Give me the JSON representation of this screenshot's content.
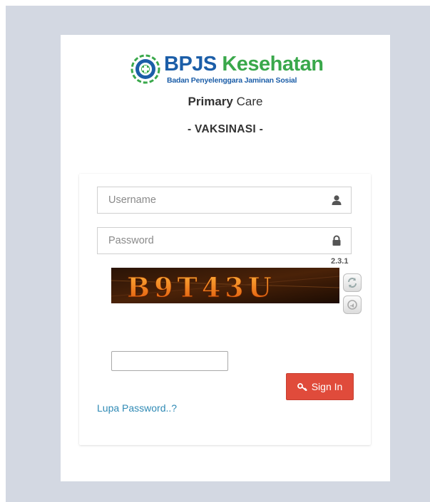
{
  "brand": {
    "name_part1": "BPJS",
    "name_part2": "Kesehatan",
    "tagline": "Badan Penyelenggara Jaminan Sosial"
  },
  "title": {
    "bold": "Primary",
    "normal": "Care"
  },
  "subtitle": "- VAKSINASI -",
  "login": {
    "username_placeholder": "Username",
    "password_placeholder": "Password",
    "version": "2.3.1",
    "captcha_text": "B9T43U",
    "captcha_input_value": "",
    "signin_label": "Sign In",
    "forgot_label": "Lupa Password..?"
  },
  "colors": {
    "brand_blue": "#1c5ea8",
    "brand_green": "#3aa84b",
    "signin_red": "#e04b3b",
    "link_blue": "#2f8ab5",
    "page_bg": "#d3d8e2"
  },
  "icons": {
    "username": "user-icon",
    "password": "lock-icon",
    "refresh": "refresh-icon",
    "audio": "audio-icon",
    "signin": "key-icon"
  }
}
